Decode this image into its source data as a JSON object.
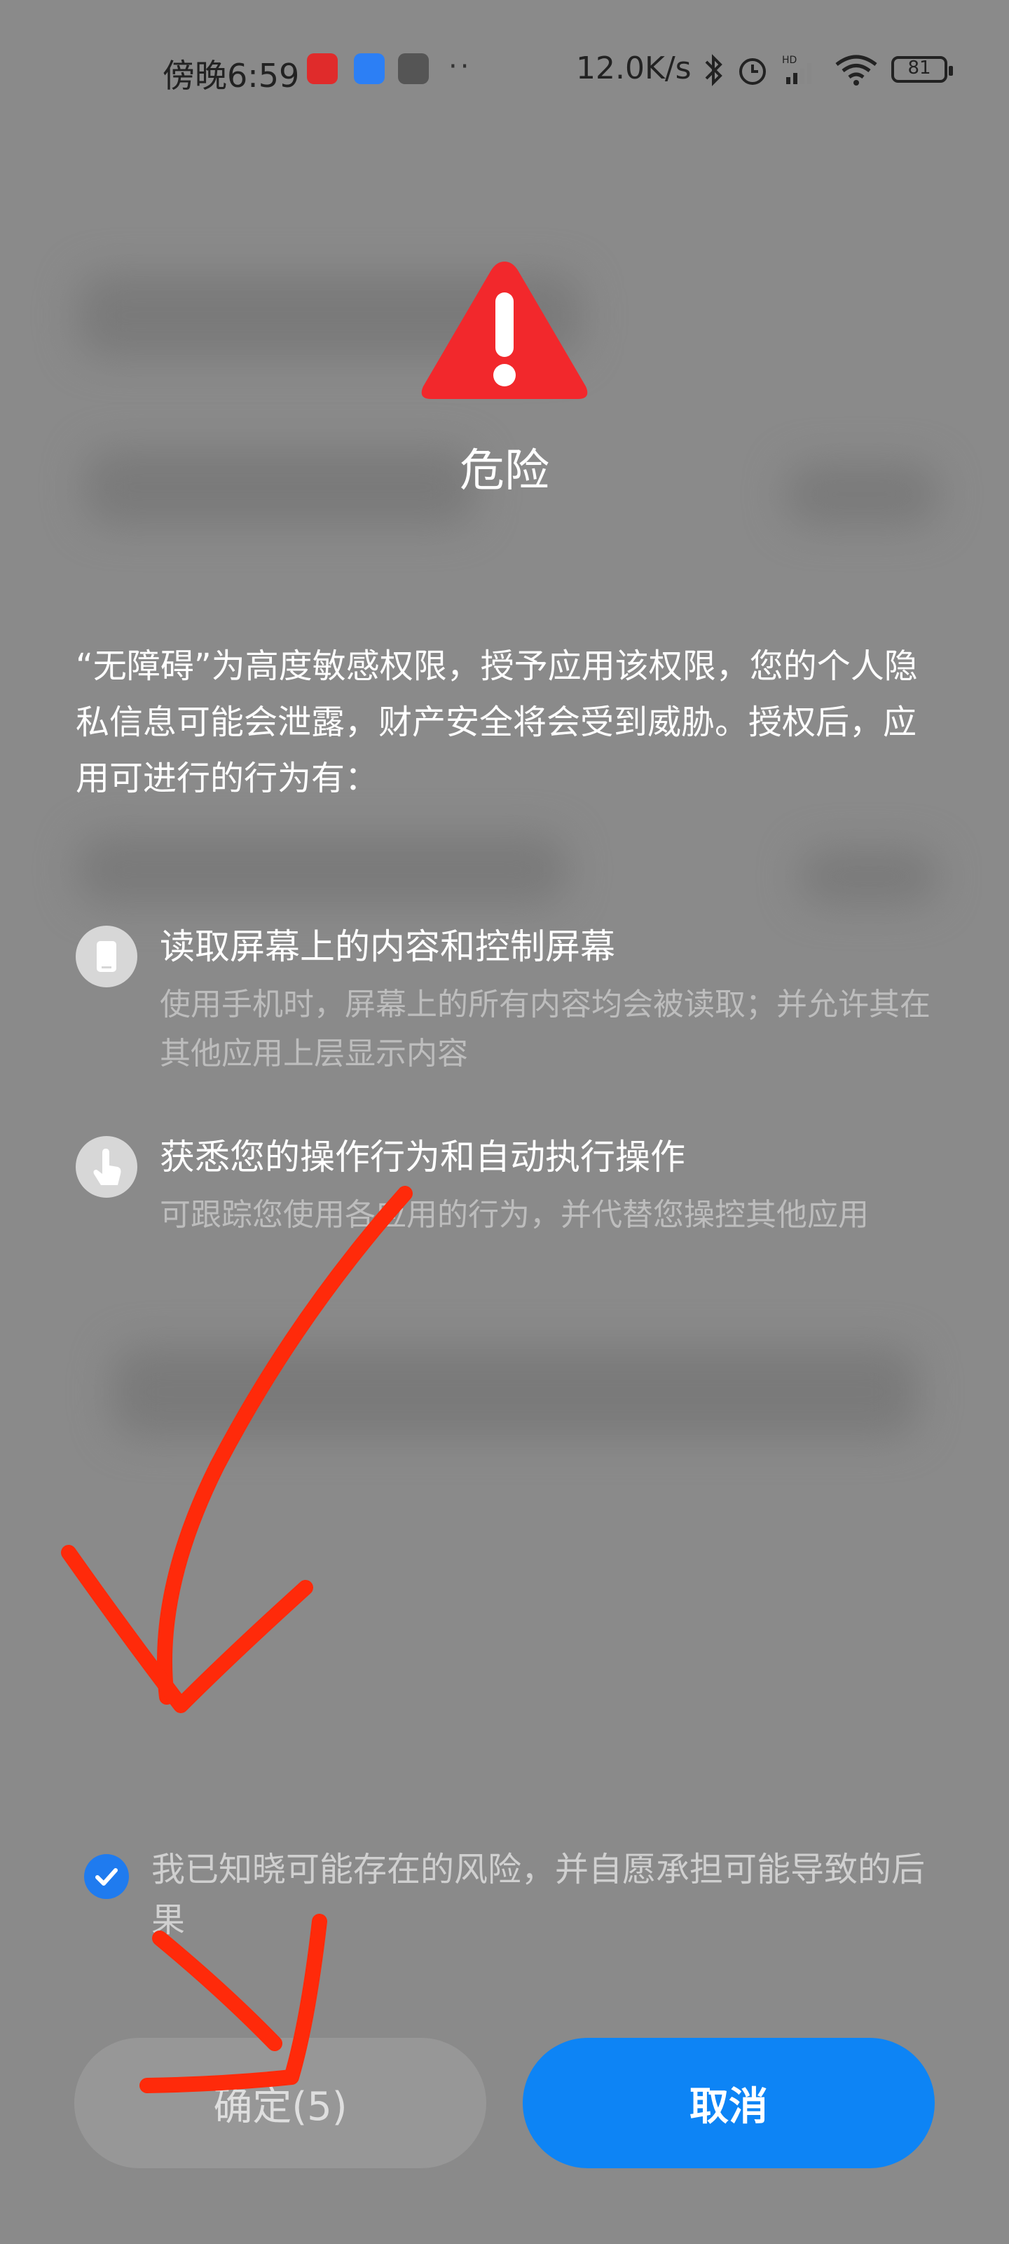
{
  "status_bar": {
    "time": "傍晚6:59",
    "speed": "12.0K/s",
    "battery": "81",
    "icons": [
      "netease-music-icon",
      "blue-app-icon",
      "notification-app-icon",
      "bluetooth-icon",
      "alarm-icon",
      "hd-signal-icon",
      "wifi-icon",
      "battery-icon"
    ]
  },
  "dialog": {
    "icon": "warning-triangle-icon",
    "title": "危险",
    "intro": "“无障碍”为高度敏感权限，授予应用该权限，您的个人隐私信息可能会泄露，财产安全将会受到威胁。授权后，应用可进行的行为有：",
    "permissions": [
      {
        "icon": "phone-icon",
        "title": "读取屏幕上的内容和控制屏幕",
        "description": "使用手机时，屏幕上的所有内容均会被读取；并允许其在其他应用上层显示内容"
      },
      {
        "icon": "hand-pointer-icon",
        "title": "获悉您的操作行为和自动执行操作",
        "description": "可跟踪您使用各应用的行为，并代替您操控其他应用"
      }
    ],
    "consent": {
      "checked": true,
      "text": "我已知晓可能存在的风险，并自愿承担可能导致的后果"
    },
    "buttons": {
      "confirm": "确定(5)",
      "cancel": "取消"
    }
  },
  "colors": {
    "overlay": "#8a8a8a",
    "warning": "#f2282c",
    "primary": "#0d84f5",
    "annotation": "#ff2a0a"
  }
}
